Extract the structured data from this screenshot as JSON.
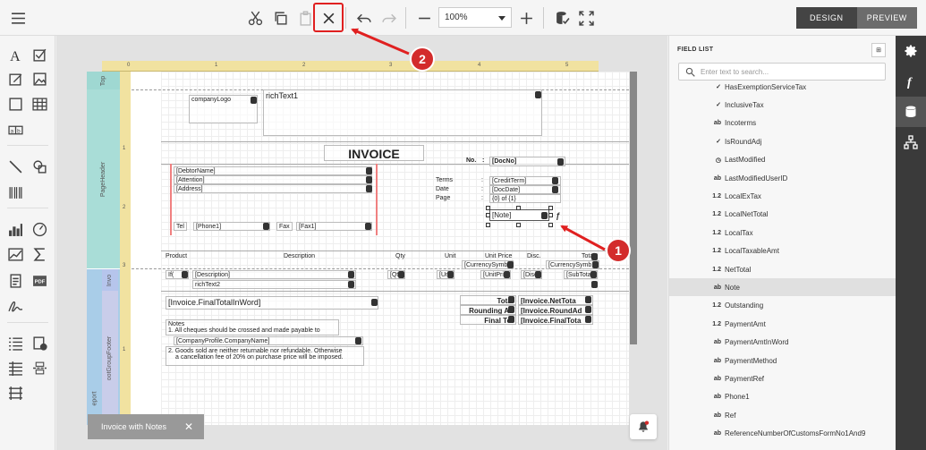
{
  "toolbar": {
    "zoom": "100%",
    "design_label": "DESIGN",
    "preview_label": "PREVIEW"
  },
  "report": {
    "bands": {
      "top": "Top",
      "page_header": "PageHeader",
      "invoice": "Invo",
      "footer": "ootGroupFooter",
      "report": "eport"
    },
    "company_logo": "companyLogo",
    "rich_text1": "richText1",
    "title": "INVOICE",
    "no_label": "No.",
    "colon": ":",
    "doc_no": "[DocNo]",
    "debtor_name": "[DebtorName]",
    "attention": "[Attention]",
    "address": "[Address]",
    "terms_label": "Terms",
    "date_label": "Date",
    "page_label": "Page",
    "credit_term": "[CreditTerm]",
    "doc_date": "[DocDate]",
    "page_of": "{0} of {1}",
    "note": "[Note]",
    "tel_label": "Tel",
    "phone1": "[Phone1]",
    "fax_label": "Fax",
    "fax1": "[Fax1]",
    "headers": [
      "Product",
      "Description",
      "Qty",
      "Unit",
      "Unit Price",
      "Disc.",
      "Total"
    ],
    "currency_symbol": "[CurrencySymb",
    "currency_symbol2": "[CurrencySymb",
    "detail": [
      "If(",
      "[Description]",
      "[Qty",
      "[Uni",
      "[UnitPrice",
      "[Disc",
      "[SubTota"
    ],
    "rich_text2": "richText2",
    "final_total_word": "[Invoice.FinalTotalInWord]",
    "notes_title": "Notes",
    "note_line1": "1. All cheques should be crossed and made payable to",
    "company_name": "[CompanyProfile.CompanyName]",
    "note_line2": "2. Goods sold are neither returnable nor refundable. Otherwise",
    "note_line3": "a cancellation fee of 20% on purchase price will be imposed.",
    "total_label": "Total",
    "total_value": "[Invoice.NetTota",
    "rounding_label": "Rounding Ad",
    "rounding_value": "[Invoice.RoundAd",
    "final_label": "Final Tot",
    "final_value": "[Invoice.FinalTota"
  },
  "ruler": {
    "top": [
      "0",
      "1",
      "2",
      "3",
      "4",
      "5",
      "6",
      "7"
    ],
    "left": [
      "1",
      "2",
      "3",
      "1"
    ]
  },
  "field_list": {
    "title": "FIELD LIST",
    "search_placeholder": "Enter text to search...",
    "items": [
      {
        "type": "✓",
        "name": "HasExemptionServiceTax"
      },
      {
        "type": "✓",
        "name": "InclusiveTax"
      },
      {
        "type": "ab",
        "name": "Incoterms"
      },
      {
        "type": "✓",
        "name": "IsRoundAdj"
      },
      {
        "type": "◷",
        "name": "LastModified"
      },
      {
        "type": "ab",
        "name": "LastModifiedUserID"
      },
      {
        "type": "1.2",
        "name": "LocalExTax"
      },
      {
        "type": "1.2",
        "name": "LocalNetTotal"
      },
      {
        "type": "1.2",
        "name": "LocalTax"
      },
      {
        "type": "1.2",
        "name": "LocalTaxableAmt"
      },
      {
        "type": "1.2",
        "name": "NetTotal"
      },
      {
        "type": "ab",
        "name": "Note",
        "selected": true
      },
      {
        "type": "1.2",
        "name": "Outstanding"
      },
      {
        "type": "1.2",
        "name": "PaymentAmt"
      },
      {
        "type": "ab",
        "name": "PaymentAmtInWord"
      },
      {
        "type": "ab",
        "name": "PaymentMethod"
      },
      {
        "type": "ab",
        "name": "PaymentRef"
      },
      {
        "type": "ab",
        "name": "Phone1"
      },
      {
        "type": "ab",
        "name": "Ref"
      },
      {
        "type": "ab",
        "name": "ReferenceNumberOfCustomsFormNo1And9"
      }
    ]
  },
  "doc_tab": {
    "label": "Invoice with Notes",
    "close": "✕"
  },
  "badges": {
    "one": "1",
    "two": "2"
  },
  "colors": {
    "accent_red": "#d32b2b",
    "design_bg": "#444444",
    "side_tabs_bg": "#3a3a3a",
    "ruler": "#f1e2a0"
  }
}
